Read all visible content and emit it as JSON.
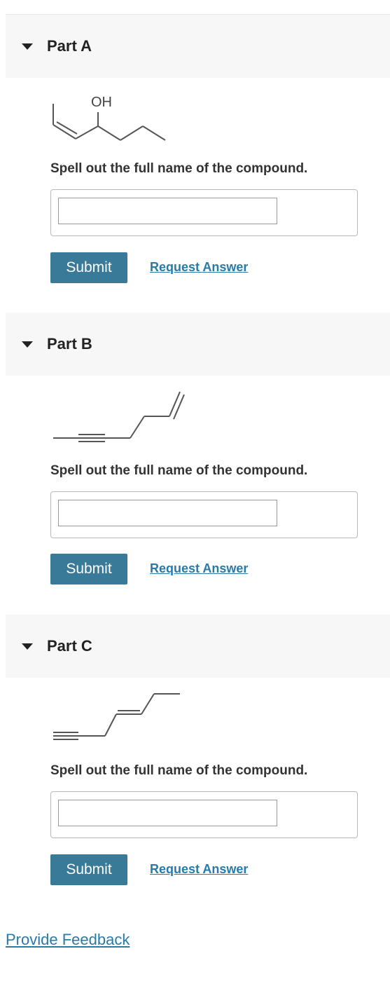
{
  "parts": [
    {
      "title": "Part A",
      "structure_label": "OH",
      "prompt": "Spell out the full name of the compound.",
      "input_value": "",
      "submit_label": "Submit",
      "request_label": "Request Answer"
    },
    {
      "title": "Part B",
      "prompt": "Spell out the full name of the compound.",
      "input_value": "",
      "submit_label": "Submit",
      "request_label": "Request Answer"
    },
    {
      "title": "Part C",
      "prompt": "Spell out the full name of the compound.",
      "input_value": "",
      "submit_label": "Submit",
      "request_label": "Request Answer"
    }
  ],
  "footer": {
    "feedback_label": "Provide Feedback"
  },
  "colors": {
    "accent": "#3a7a99",
    "link": "#2a7aa8",
    "header_bg": "#f7f7f7"
  },
  "icons": {
    "collapse": "caret-down-icon"
  }
}
